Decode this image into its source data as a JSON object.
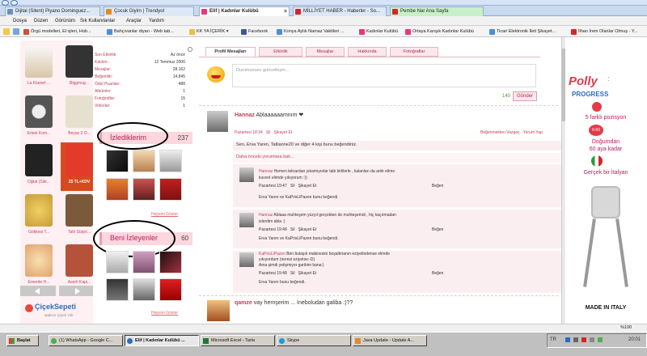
{
  "browser_tabs": [
    {
      "label": "Dijital (Silent) Piyano Dominguez...",
      "color": "#6d8fb5"
    },
    {
      "label": "Çocuk Giyim | Trendyol",
      "color": "#e08a2c"
    },
    {
      "label": "Elif | Kadınlar Kulübü",
      "color": "#e6397a"
    },
    {
      "label": "MİLLİYET HABER - Haberler - So...",
      "color": "#d42626"
    },
    {
      "label": "Pembe Nar Ana Sayfa",
      "color": "#d42626"
    }
  ],
  "menu_items": [
    "Dosya",
    "Düzen",
    "Görünüm",
    "Sık Kullanılanlar",
    "Araçlar",
    "Yardım"
  ],
  "bookmarks": [
    "Örgü modelleri, El işleri, Hob...",
    "Bahçıvanlar diyarı - Web tab...",
    "KK YA İÇERİK ▾",
    "Facebook",
    "Konya Aylık Namaz Vakitleri ...",
    "Kadınlar Kulübü",
    "Ortaya Karışık Kadınlar Kulübü",
    "Ticari Elektronik İleti Şikayet...",
    "İlhan İrem Olanlar Olmuş - Y..."
  ],
  "products": [
    {
      "label": "La Klarnet ...",
      "color": "#d9c6a8"
    },
    {
      "label": "Biggmug...",
      "color": "#333"
    },
    {
      "label": "Erkek Kom...",
      "color": "#555"
    },
    {
      "label": "Beyaz 2 O...",
      "color": "#e6e0cf"
    },
    {
      "label": "Dijital (Sile...",
      "color": "#222"
    },
    {
      "label": "25 TL+KDV",
      "color": "#d64a1e"
    },
    {
      "label": "Gökkesi T...",
      "color": "#c79b3a"
    },
    {
      "label": "Tatlı Sürpri...",
      "color": "#7a5a3a"
    },
    {
      "label": "Emerde H...",
      "color": "#e0a36d"
    },
    {
      "label": "Asorti Kapi...",
      "color": "#b5523a"
    }
  ],
  "logo": {
    "brand": "ÇiçekSepeti",
    "tagline": "sadece Çiçek Yok"
  },
  "stats": [
    {
      "k": "Son Etkinlik:",
      "v": "Az önce"
    },
    {
      "k": "Katılım:",
      "v": "12 Temmuz 2006"
    },
    {
      "k": "Mesajlar:",
      "v": "28.162"
    },
    {
      "k": "Beğenildi:",
      "v": "14.845"
    },
    {
      "k": "Ödül Puanları:",
      "v": "488"
    },
    {
      "k": "Albümler:",
      "v": "1"
    },
    {
      "k": "Fotoğraflar:",
      "v": "15"
    },
    {
      "k": "Videolar:",
      "v": "1"
    }
  ],
  "following": {
    "title": "İzlediklerim",
    "count": "237",
    "show_all": "Hepsini Göster"
  },
  "followers": {
    "title": "Beni İzleyenler",
    "count": "60",
    "show_all": "Hepsini Göster"
  },
  "profile_tabs": [
    "Profil Mesajları",
    "Etkinlik",
    "Mesajlar",
    "Hakkında",
    "Fotoğraflar"
  ],
  "status": {
    "placeholder": "Durumunuzu güncelleyin...",
    "char_count": "140",
    "submit": "Gönder"
  },
  "post1": {
    "user": "Hannaz",
    "text": "Ablaaaaaamnım ❤",
    "time": "Pazartesi 18:34",
    "delete": "Sil",
    "report": "Şikayet Et",
    "undo_like": "Beğenmekten Vazgeç",
    "reply": "Yorum Yap",
    "likes": "Sen, Erva Yaren, Tatlianne20 ve diğer 4 kişi bunu beğendiniz.",
    "older": "Daha önceki yorumlara bak..."
  },
  "comments": [
    {
      "user": "Hannaz",
      "text": "Hemen tekrardan yıkamıyorlar tabi kirlilerle , kalanları da artık elime",
      "text2": "kuvvet elimde yıkıyorum :))",
      "time": "Pazartesi 19:47",
      "like": "Beğen",
      "liked": "Erva Yaren ve KaPrisLiPazen bunu beğendi."
    },
    {
      "user": "Hannaz",
      "text": "Ablaaa muhteşem yüzyıl gerçekten de muhteşemdi , hiç kaçırmadan",
      "text2": "izlerdim abla :)",
      "time": "Pazartesi 19:48",
      "like": "Beğen",
      "liked": "Erva Yaren ve KaPrisLiPazen bunu beğendi."
    },
    {
      "user": "KaPrisLiPazen",
      "text": "Ben bulaşık makinesini boşaltmanın eziyetindense elimde",
      "text2": "yıkıyordum (neresi eziyetse:-D)",
      "text3": "Ama şimdi yetişmiyor garibim bana:)",
      "time": "Pazartesi 19:48",
      "like": "Beğen",
      "liked": "Erva Yaren bunu beğendi."
    }
  ],
  "post2": {
    "user": "qamze",
    "text": "vay hemşerim ... İneboludan galiba :)??"
  },
  "common": {
    "delete": "Sil",
    "report": "Şikayet Et"
  },
  "ad": {
    "brand": "Polly",
    "brand2": "PROGRESS",
    "feature1": "5 farklı pozisyon",
    "age": "0-60",
    "feature2a": "Doğumdan",
    "feature2b": "60 aya kadar",
    "feature3": "Gerçek bir İtalyan",
    "made": "MADE IN ITALY"
  },
  "zoom": "%100",
  "taskbar": {
    "start": "Başlat",
    "items": [
      "(1) WhatsApp - Google C...",
      "Elif | Kadınlar Kulübü ...",
      "Microsoft Excel - Tarla",
      "Skype",
      "Java Update - Update A..."
    ],
    "lang": "TR",
    "clock": "20:01"
  },
  "colors": {
    "accent": "#c2405a",
    "pink_bg": "#fff0f3",
    "header_pink": "#fbd7de"
  }
}
